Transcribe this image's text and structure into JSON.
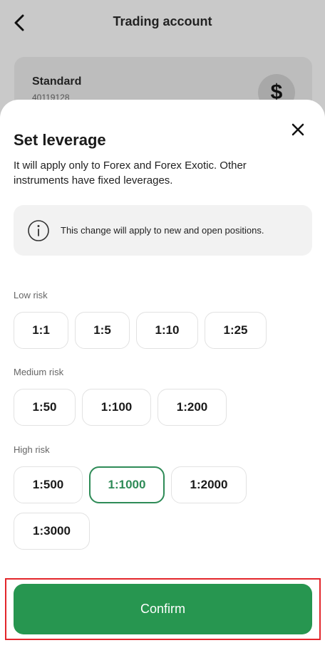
{
  "header": {
    "title": "Trading account"
  },
  "account": {
    "name": "Standard",
    "number": "40119128",
    "currency_symbol": "$"
  },
  "sheet": {
    "title": "Set leverage",
    "description": "It will apply only to Forex and Forex Exotic. Other instruments have fixed leverages.",
    "info_text": "This change will apply to new and open positions."
  },
  "groups": {
    "low": {
      "label": "Low risk",
      "options": [
        "1:1",
        "1:5",
        "1:10",
        "1:25"
      ]
    },
    "medium": {
      "label": "Medium risk",
      "options": [
        "1:50",
        "1:100",
        "1:200"
      ]
    },
    "high": {
      "label": "High risk",
      "options": [
        "1:500",
        "1:1000",
        "1:2000",
        "1:3000"
      ]
    }
  },
  "selected": "1:1000",
  "confirm_label": "Confirm",
  "colors": {
    "accent": "#279650",
    "selected_border": "#2e8b57",
    "highlight": "#e3262b"
  },
  "icons": {
    "back": "chevron-left-icon",
    "close": "close-icon",
    "info": "info-icon"
  }
}
